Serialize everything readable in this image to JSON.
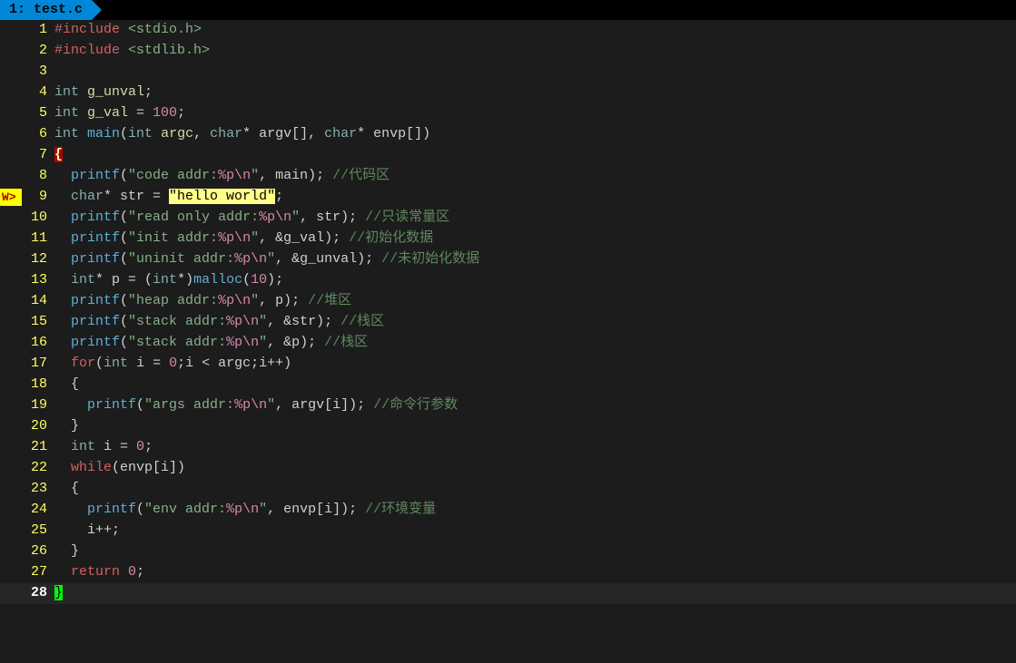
{
  "tab": {
    "label": "1: test.c"
  },
  "sign": {
    "warning": "W>"
  },
  "linenos": [
    "1",
    "2",
    "3",
    "4",
    "5",
    "6",
    "7",
    "8",
    "9",
    "10",
    "11",
    "12",
    "13",
    "14",
    "15",
    "16",
    "17",
    "18",
    "19",
    "20",
    "21",
    "22",
    "23",
    "24",
    "25",
    "26",
    "27",
    "28"
  ],
  "code": {
    "l1": {
      "pp": "#include ",
      "inc": "<stdio.h>"
    },
    "l2": {
      "pp": "#include ",
      "inc": "<stdlib.h>"
    },
    "l4": {
      "kw": "int",
      "id": " g_unval",
      "end": ";"
    },
    "l5": {
      "kw": "int",
      "id": " g_val ",
      "eq": "= ",
      "num": "100",
      "end": ";"
    },
    "l6": {
      "kw1": "int",
      "fn": " main",
      "p1": "(",
      "kw2": "int",
      "id1": " argc, ",
      "kw3": "char",
      "p2": "* argv[], ",
      "kw4": "char",
      "p3": "* envp[])"
    },
    "l7": {
      "brace": "{"
    },
    "l8": {
      "sp": "  ",
      "fn": "printf",
      "p1": "(",
      "s1": "\"code addr:",
      "esc1": "%p\\n",
      "s2": "\"",
      "p2": ", main); ",
      "cmt": "//代码区"
    },
    "l9": {
      "sp": "  ",
      "kw": "char",
      "p1": "* str = ",
      "s": "\"hello world\"",
      "end": ";"
    },
    "l10": {
      "sp": "  ",
      "fn": "printf",
      "p1": "(",
      "s1": "\"read only addr:",
      "esc1": "%p\\n",
      "s2": "\"",
      "p2": ", str); ",
      "cmt": "//只读常量区"
    },
    "l11": {
      "sp": "  ",
      "fn": "printf",
      "p1": "(",
      "s1": "\"init addr:",
      "esc1": "%p\\n",
      "s2": "\"",
      "p2": ", &g_val); ",
      "cmt": "//初始化数据"
    },
    "l12": {
      "sp": "  ",
      "fn": "printf",
      "p1": "(",
      "s1": "\"uninit addr:",
      "esc1": "%p\\n",
      "s2": "\"",
      "p2": ", &g_unval); ",
      "cmt": "//未初始化数据"
    },
    "l13": {
      "sp": "  ",
      "kw": "int",
      "p1": "* p = (",
      "kw2": "int",
      "p2": "*)",
      "fn": "malloc",
      "p3": "(",
      "num": "10",
      "p4": ");"
    },
    "l14": {
      "sp": "  ",
      "fn": "printf",
      "p1": "(",
      "s1": "\"heap addr:",
      "esc1": "%p\\n",
      "s2": "\"",
      "p2": ", p); ",
      "cmt": "//堆区"
    },
    "l15": {
      "sp": "  ",
      "fn": "printf",
      "p1": "(",
      "s1": "\"stack addr:",
      "esc1": "%p\\n",
      "s2": "\"",
      "p2": ", &str); ",
      "cmt": "//栈区"
    },
    "l16": {
      "sp": "  ",
      "fn": "printf",
      "p1": "(",
      "s1": "\"stack addr:",
      "esc1": "%p\\n",
      "s2": "\"",
      "p2": ", &p); ",
      "cmt": "//栈区"
    },
    "l17": {
      "sp": "  ",
      "kw1": "for",
      "p1": "(",
      "kw2": "int",
      "p2": " i = ",
      "num1": "0",
      "p3": ";i < argc;i++)"
    },
    "l18": {
      "sp": "  ",
      "brace": "{"
    },
    "l19": {
      "sp": "    ",
      "fn": "printf",
      "p1": "(",
      "s1": "\"args addr:",
      "esc1": "%p\\n",
      "s2": "\"",
      "p2": ", argv[i]); ",
      "cmt": "//命令行参数"
    },
    "l20": {
      "sp": "  ",
      "brace": "}"
    },
    "l21": {
      "sp": "  ",
      "kw": "int",
      "p1": " i = ",
      "num": "0",
      "end": ";"
    },
    "l22": {
      "sp": "  ",
      "kw": "while",
      "p1": "(envp[i])"
    },
    "l23": {
      "sp": "  ",
      "brace": "{"
    },
    "l24": {
      "sp": "    ",
      "fn": "printf",
      "p1": "(",
      "s1": "\"env addr:",
      "esc1": "%p\\n",
      "s2": "\"",
      "p2": ", envp[i]); ",
      "cmt": "//环境变量"
    },
    "l25": {
      "sp": "    ",
      "txt": "i++;"
    },
    "l26": {
      "sp": "  ",
      "brace": "}"
    },
    "l27": {
      "sp": "  ",
      "kw": "return",
      "sp2": " ",
      "num": "0",
      "end": ";"
    },
    "l28": {
      "brace": "}"
    }
  }
}
